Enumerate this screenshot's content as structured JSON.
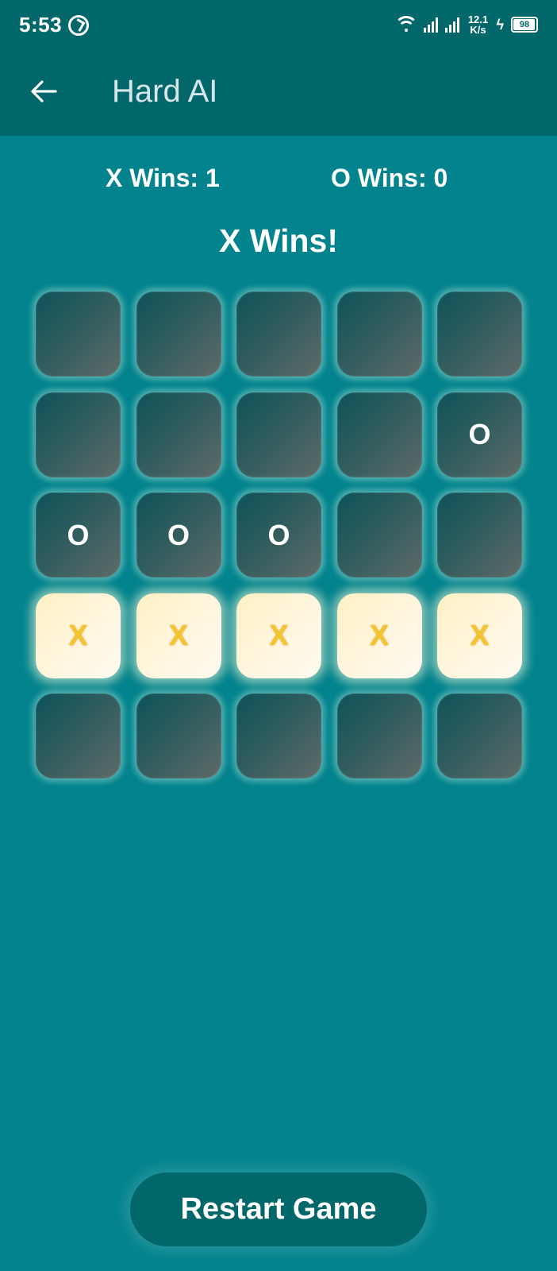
{
  "status_bar": {
    "time": "5:53",
    "speed_value": "12.1",
    "speed_unit": "K/s",
    "battery": "98"
  },
  "app_bar": {
    "title": "Hard AI",
    "back_icon": "arrow-left-icon"
  },
  "scores": {
    "x_label": "X Wins: 1",
    "o_label": "O Wins: 0"
  },
  "game_status": "X Wins!",
  "board": {
    "size": 5,
    "cells": [
      "",
      "",
      "",
      "",
      "",
      "",
      "",
      "",
      "",
      "O",
      "O",
      "O",
      "O",
      "",
      "",
      "X",
      "X",
      "X",
      "X",
      "X",
      "",
      "",
      "",
      "",
      ""
    ],
    "winning_cells": [
      15,
      16,
      17,
      18,
      19
    ]
  },
  "restart_label": "Restart Game",
  "colors": {
    "background": "#02838d",
    "app_bar": "#02676b",
    "win_mark": "#f4c430"
  }
}
